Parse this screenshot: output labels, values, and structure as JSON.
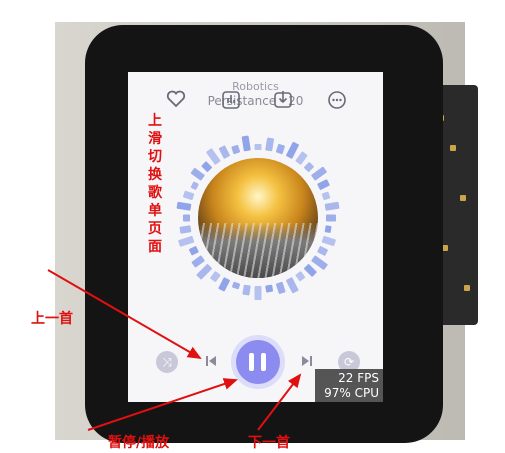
{
  "screen": {
    "title": "Robotics",
    "artist": "Persistance - 20",
    "fps": "22 FPS",
    "cpu": "97% CPU"
  },
  "annotations": {
    "swipe_up": "上滑切换歌单页面",
    "prev": "上一首",
    "play_pause": "暂停/播放",
    "next": "下一首"
  },
  "icons": {
    "like": "heart-icon",
    "eq": "equalizer-icon",
    "download": "download-icon",
    "menu": "more-icon",
    "shuffle": "shuffle-icon",
    "prev": "skip-previous-icon",
    "play": "pause-icon",
    "next": "skip-next-icon",
    "repeat": "repeat-icon"
  },
  "colors": {
    "accent": "#8c8cf0",
    "annotation": "#e01010",
    "spectrum": "#7f95e6"
  }
}
